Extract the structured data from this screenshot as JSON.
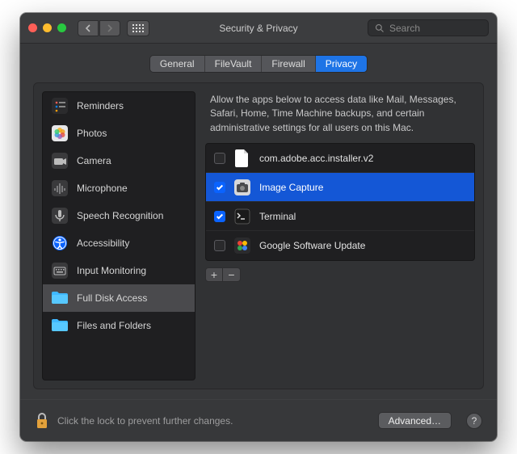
{
  "window": {
    "title": "Security & Privacy",
    "traffic": {
      "close": "#ff5f57",
      "min": "#febc2e",
      "max": "#28c840"
    }
  },
  "search": {
    "placeholder": "Search"
  },
  "tabs": [
    {
      "label": "General",
      "active": false
    },
    {
      "label": "FileVault",
      "active": false
    },
    {
      "label": "Firewall",
      "active": false
    },
    {
      "label": "Privacy",
      "active": true
    }
  ],
  "sidebar": {
    "items": [
      {
        "label": "Reminders",
        "icon": "reminders"
      },
      {
        "label": "Photos",
        "icon": "photos"
      },
      {
        "label": "Camera",
        "icon": "camera"
      },
      {
        "label": "Microphone",
        "icon": "microphone"
      },
      {
        "label": "Speech Recognition",
        "icon": "speech"
      },
      {
        "label": "Accessibility",
        "icon": "accessibility"
      },
      {
        "label": "Input Monitoring",
        "icon": "keyboard"
      },
      {
        "label": "Full Disk Access",
        "icon": "folder-blue",
        "selected": true
      },
      {
        "label": "Files and Folders",
        "icon": "folder-blue"
      }
    ]
  },
  "main": {
    "description": "Allow the apps below to access data like Mail, Messages, Safari, Home, Time Machine backups, and certain administrative settings for all users on this Mac.",
    "apps": [
      {
        "name": "com.adobe.acc.installer.v2",
        "checked": false,
        "selected": false,
        "icon": "doc"
      },
      {
        "name": "Image Capture",
        "checked": true,
        "selected": true,
        "icon": "imagecapture"
      },
      {
        "name": "Terminal",
        "checked": true,
        "selected": false,
        "icon": "terminal"
      },
      {
        "name": "Google Software Update",
        "checked": false,
        "selected": false,
        "icon": "gsu"
      }
    ],
    "add_label": "+",
    "remove_label": "−"
  },
  "footer": {
    "lock_text": "Click the lock to prevent further changes.",
    "advanced_label": "Advanced…",
    "help_label": "?"
  }
}
